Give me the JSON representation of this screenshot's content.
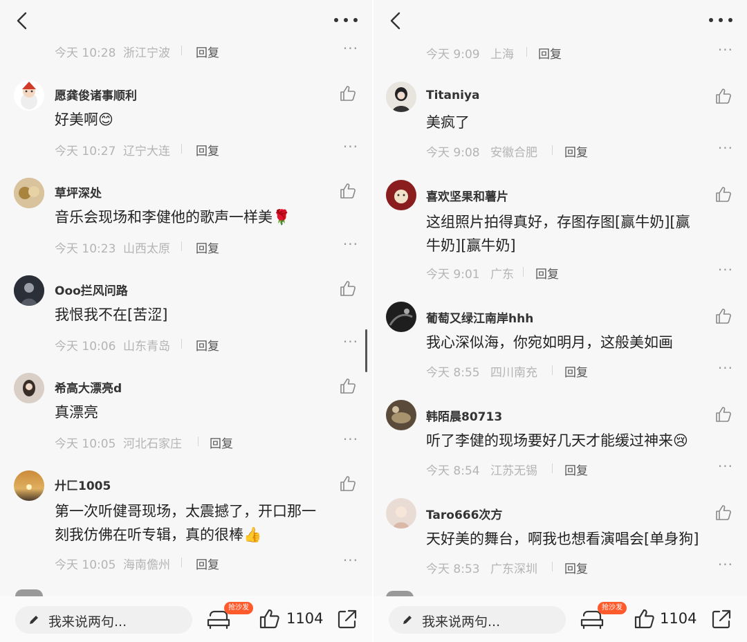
{
  "left": {
    "top_meta": {
      "time": "今天 10:28",
      "location": "浙江宁波",
      "reply": "回复"
    },
    "comments": [
      {
        "user": "愿龚俊诸事顺利",
        "text": "好美啊",
        "emoji": "😊",
        "time": "今天 10:27",
        "location": "辽宁大连",
        "reply": "回复"
      },
      {
        "user": "草坪深处",
        "text": "音乐会现场和李健他的歌声一样美",
        "emoji": "🌹",
        "time": "今天 10:23",
        "location": "山西太原",
        "reply": "回复"
      },
      {
        "user": "Ooo拦风问路",
        "text": "我恨我不在[苦涩]",
        "time": "今天 10:06",
        "location": "山东青岛",
        "reply": "回复"
      },
      {
        "user": "希高大漂亮d",
        "text": "真漂亮",
        "time": "今天 10:05",
        "location": "河北石家庄",
        "reply": "回复"
      },
      {
        "user": "廾匚1005",
        "text_lines": [
          "第一次听健哥现场，太震撼了，开口那一",
          "刻我仿佛在听专辑，真的很棒"
        ],
        "emoji": "👍",
        "time": "今天 10:05",
        "location": "海南儋州",
        "reply": "回复"
      }
    ],
    "bottom": {
      "placeholder": "我来说两句...",
      "badge": "抢沙发",
      "like_count": "1104"
    }
  },
  "right": {
    "top_meta": {
      "time": "今天 9:09",
      "location": "上海",
      "reply": "回复"
    },
    "comments": [
      {
        "user": "Titaniya",
        "text": "美疯了",
        "time": "今天 9:08",
        "location": "安徽合肥",
        "reply": "回复"
      },
      {
        "user": "喜欢坚果和薯片",
        "text_lines": [
          "这组照片拍得真好，存图存图[赢牛奶][赢",
          "牛奶][赢牛奶]"
        ],
        "time": "今天 9:01",
        "location": "广东",
        "reply": "回复"
      },
      {
        "user": "葡萄又绿江南岸hhh",
        "text": "我心深似海，你宛如明月，这般美如画",
        "time": "今天 8:55",
        "location": "四川南充",
        "reply": "回复"
      },
      {
        "user": "韩陌晨80713",
        "text": "听了李健的现场要好几天才能缓过神来",
        "emoji": "😢",
        "time": "今天 8:54",
        "location": "江苏无锡",
        "reply": "回复"
      },
      {
        "user": "Taro666次方",
        "text": "天好美的舞台，啊我也想看演唱会[单身狗]",
        "time": "今天 8:53",
        "location": "广东深圳",
        "reply": "回复"
      }
    ],
    "bottom": {
      "placeholder": "我来说两句...",
      "badge": "抢沙发",
      "like_count": "1104"
    }
  },
  "icons": {
    "back": "chevron-left-icon",
    "more": "more-dots-icon",
    "like": "thumbs-up-icon",
    "sofa": "sofa-icon",
    "share": "share-icon",
    "pen": "pen-icon"
  },
  "colors": {
    "badge": "#ff5a2b",
    "meta": "#b4b4b4",
    "background": "#f7f7f7"
  }
}
